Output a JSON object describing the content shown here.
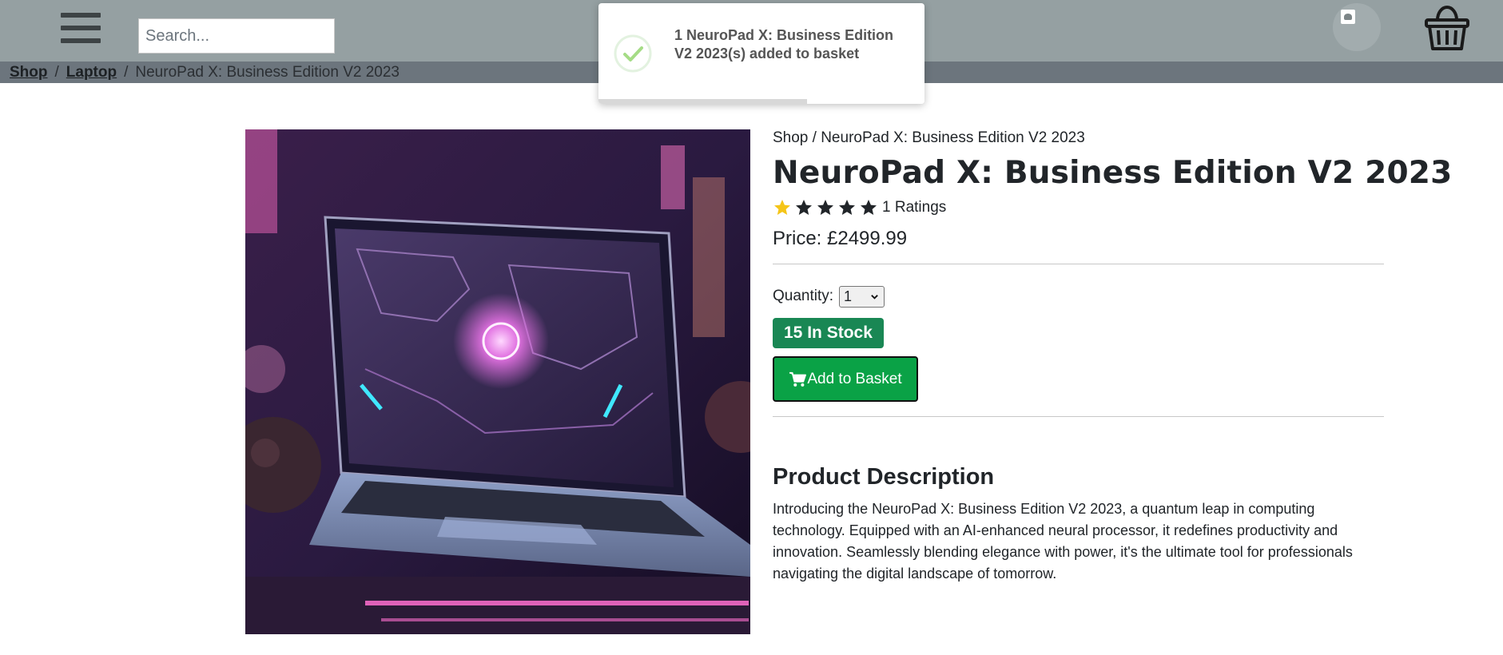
{
  "header": {
    "search_placeholder": "Search..."
  },
  "breadcrumb": {
    "items": [
      {
        "label": "Shop"
      },
      {
        "label": "Laptop"
      },
      {
        "label": "NeuroPad X: Business Edition V2 2023"
      }
    ],
    "separator": "/"
  },
  "toast": {
    "message": "1 NeuroPad X: Business Edition V2 2023(s) added to basket",
    "progress": 0.64,
    "icon": "check-circle-icon"
  },
  "product": {
    "inner_breadcrumb": "Shop / NeuroPad X: Business Edition V2 2023",
    "title": "NeuroPad X: Business Edition V2 2023",
    "rating": 1,
    "rating_max": 5,
    "ratings_label": "1 Ratings",
    "price_label": "Price: £2499.99",
    "quantity_label": "Quantity:",
    "quantity_value": "1",
    "stock_label": "15 In Stock",
    "add_button_label": "Add to Basket",
    "description_heading": "Product Description",
    "description": "Introducing the NeuroPad X: Business Edition V2 2023, a quantum leap in computing technology. Equipped with an AI-enhanced neural processor, it redefines productivity and innovation. Seamlessly blending elegance with power, it's the ultimate tool for professionals navigating the digital landscape of tomorrow."
  },
  "colors": {
    "topbar": "#95a0a2",
    "crumbbar": "#6c757d",
    "stock_badge": "#198754",
    "add_button": "#0aa246",
    "star_filled": "#f5c518",
    "star_empty": "#212529"
  }
}
